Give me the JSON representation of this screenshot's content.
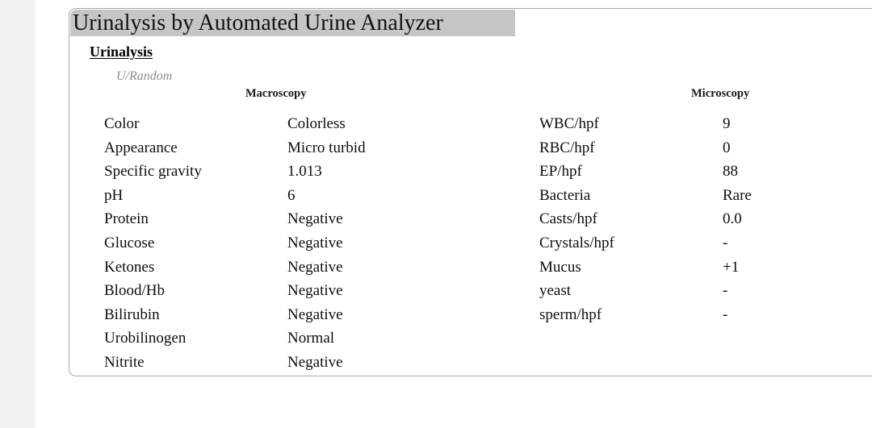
{
  "page": {
    "background_color": "#ffffff",
    "gutter_color": "#f0f1f3"
  },
  "card": {
    "border_color": "#a8a8a8",
    "background_color": "#ffffff"
  },
  "report": {
    "title": "Urinalysis by Automated Urine Analyzer",
    "title_highlight_color": "#c6c6c6",
    "section_heading": "Urinalysis",
    "specimen_label": "U/Random",
    "specimen_label_color": "#8d8d8d"
  },
  "macroscopy": {
    "header": "Macroscopy",
    "rows": [
      {
        "label": "Color",
        "value": "Colorless"
      },
      {
        "label": "Appearance",
        "value": "Micro turbid"
      },
      {
        "label": "Specific gravity",
        "value": "1.013"
      },
      {
        "label": "pH",
        "value": "6"
      },
      {
        "label": "Protein",
        "value": "Negative"
      },
      {
        "label": "Glucose",
        "value": "Negative"
      },
      {
        "label": "Ketones",
        "value": "Negative"
      },
      {
        "label": "Blood/Hb",
        "value": "Negative"
      },
      {
        "label": "Bilirubin",
        "value": "Negative"
      },
      {
        "label": "Urobilinogen",
        "value": "Normal"
      },
      {
        "label": "Nitrite",
        "value": "Negative"
      }
    ]
  },
  "microscopy": {
    "header": "Microscopy",
    "rows": [
      {
        "label": "WBC/hpf",
        "value": "9"
      },
      {
        "label": "RBC/hpf",
        "value": "0"
      },
      {
        "label": "EP/hpf",
        "value": "88"
      },
      {
        "label": "Bacteria",
        "value": "Rare"
      },
      {
        "label": "Casts/hpf",
        "value": "0.0"
      },
      {
        "label": "Crystals/hpf",
        "value": "-"
      },
      {
        "label": "Mucus",
        "value": "+1"
      },
      {
        "label": "yeast",
        "value": "-"
      },
      {
        "label": "sperm/hpf",
        "value": "-"
      }
    ]
  }
}
